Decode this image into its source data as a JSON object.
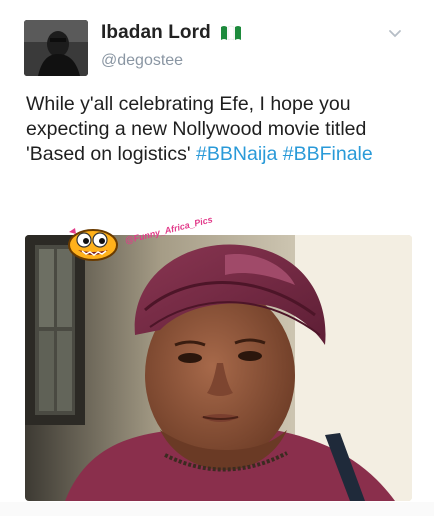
{
  "tweet": {
    "display_name": "Ibadan Lord",
    "handle": "@degostee",
    "text_plain": "While y'all celebrating Efe, I hope you expecting a new Nollywood movie titled 'Based on logistics'",
    "hashtag_1": "#BBNaija",
    "hashtag_2": "#BBFinale"
  },
  "media": {
    "watermark": "@Funny_Africa_Pics"
  },
  "colors": {
    "hashtag": "#2a9ad8",
    "flag_green": "#1d8a3c",
    "headwrap": "#7a2a45"
  },
  "icons": {
    "menu": "chevron-down-icon",
    "flag": "nigeria-flag-icon"
  }
}
